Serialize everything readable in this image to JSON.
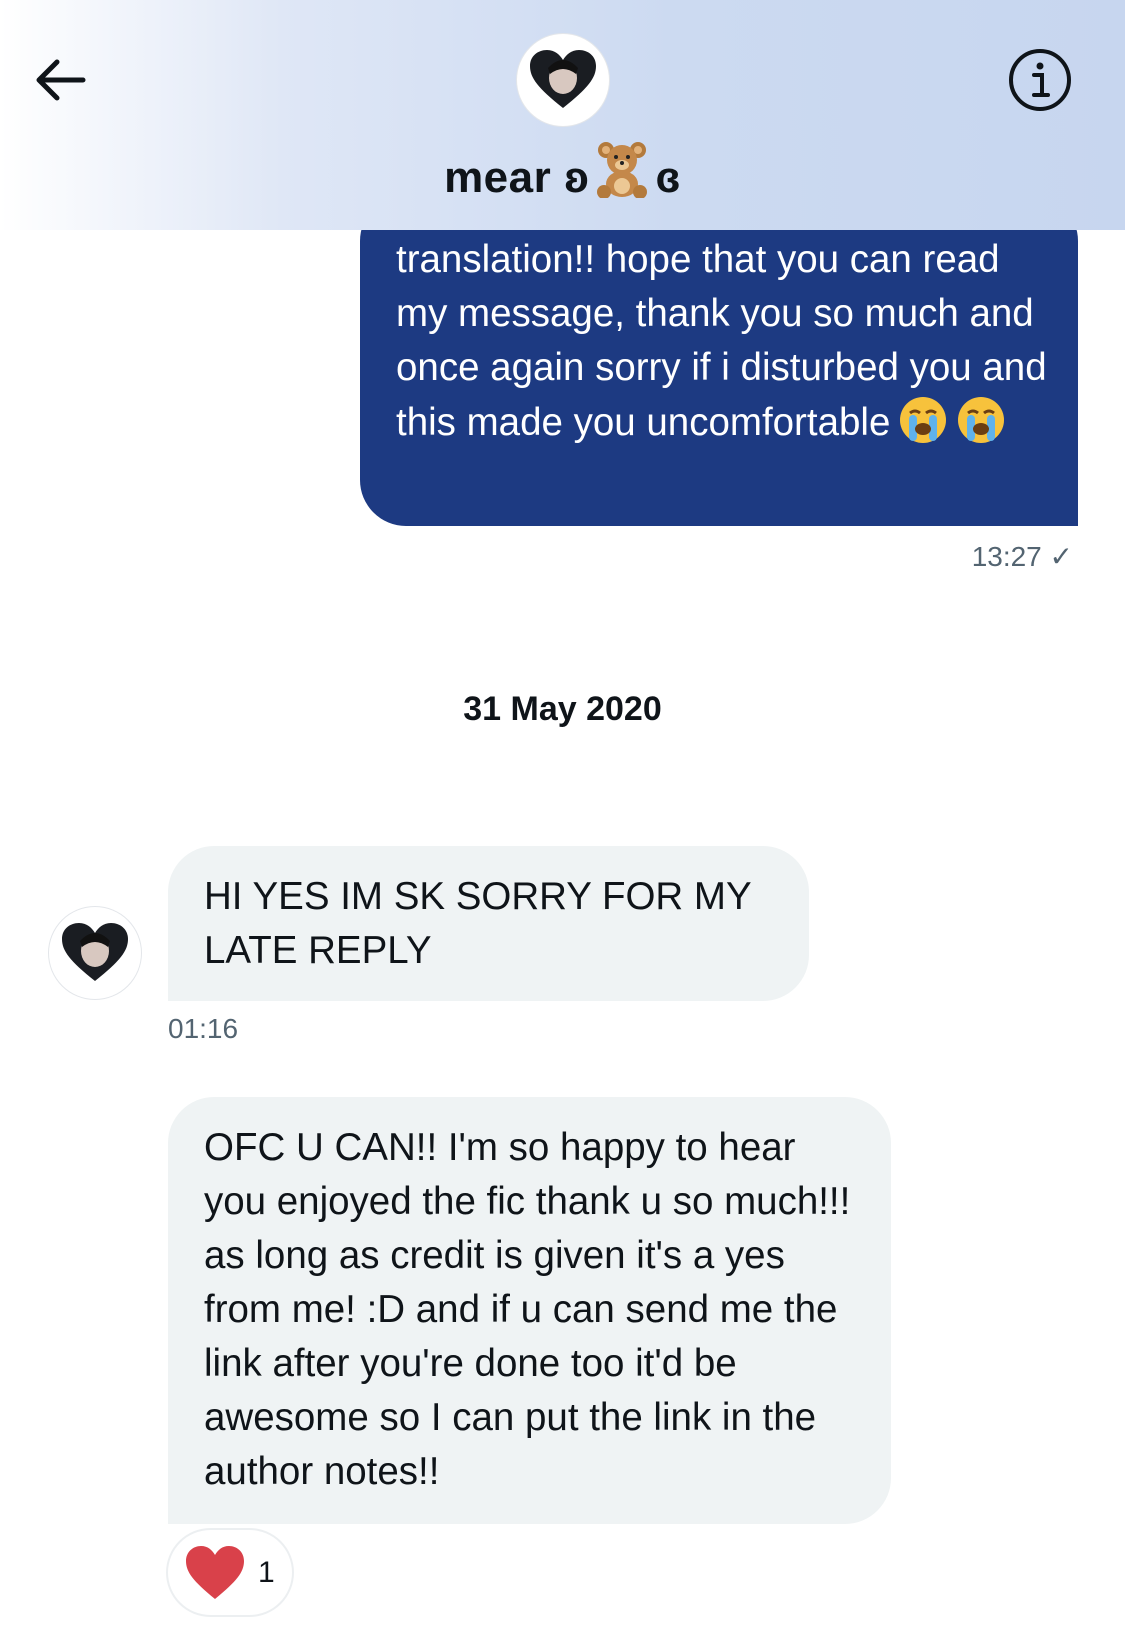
{
  "header": {
    "contact_name_prefix": "mear ʚ",
    "contact_name_suffix": "ɞ",
    "name_emoji": "teddy-bear-emoji",
    "back_icon": "arrow-left-icon",
    "info_icon": "info-circle-icon"
  },
  "messages": [
    {
      "direction": "outgoing",
      "text": "translation!! hope that you can read my message, thank you so much and once again sorry if i disturbed you and this made you uncomfortable",
      "emojis": [
        "crying-face-emoji",
        "crying-face-emoji"
      ],
      "time": "13:27 ✓"
    }
  ],
  "date_divider": "31 May 2020",
  "incoming": [
    {
      "text": "HI YES IM SK SORRY FOR MY LATE REPLY",
      "time": "01:16"
    },
    {
      "text": "OFC U CAN!! I'm so happy to hear you enjoyed the fic thank u so much!!! as long as credit is given it's a yes from me! :D and if u can send me the link after you're done too it'd be awesome so I can put the link in the author notes!!",
      "reaction": {
        "icon": "heart-icon",
        "count": "1"
      }
    }
  ],
  "colors": {
    "outgoing_bubble": "#1d3a82",
    "incoming_bubble": "#eff3f4",
    "header_gradient_end": "#c7d6ef",
    "heart": "#d9414a"
  }
}
